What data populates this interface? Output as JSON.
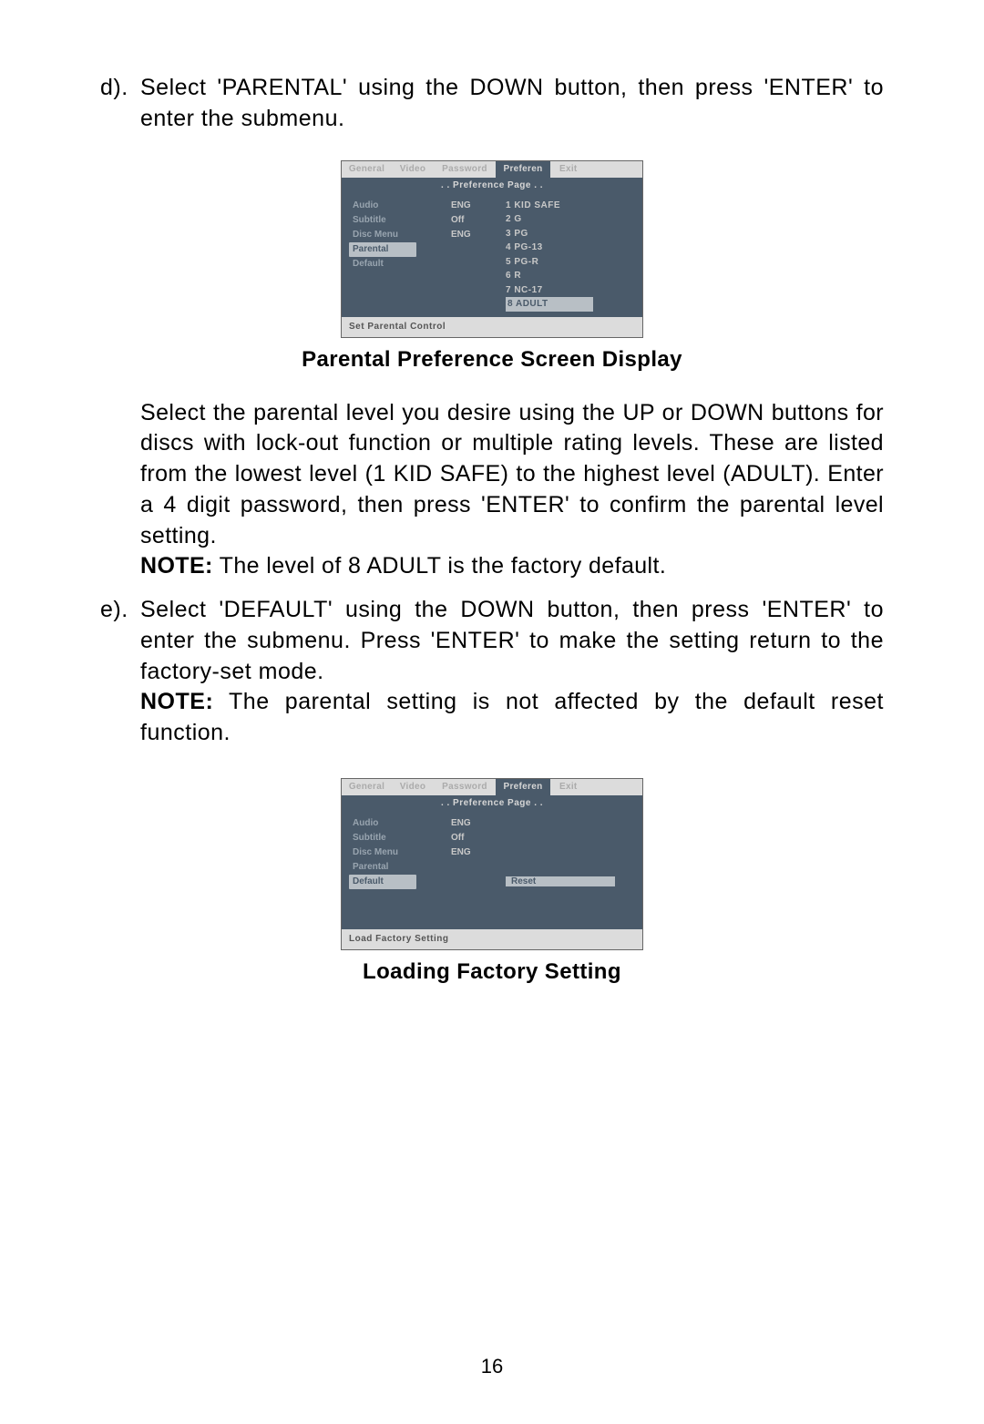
{
  "step_d": {
    "marker": "d).",
    "text": "Select 'PARENTAL' using the DOWN button, then press 'ENTER' to enter the submenu."
  },
  "figure1": {
    "tabs": {
      "general": "General",
      "video": "Video",
      "password": "Password",
      "preferen": "Preferen",
      "exit": "Exit"
    },
    "title": ". . Preference Page . .",
    "menu_items": [
      "Audio",
      "Subtitle",
      "Disc Menu",
      "Parental",
      "Default"
    ],
    "menu_selected_index": 3,
    "mid_values": [
      "ENG",
      "Off",
      "ENG"
    ],
    "right_items": [
      "1 KID SAFE",
      "2 G",
      "3 PG",
      "4 PG-13",
      "5 PG-R",
      "6 R",
      "7 NC-17",
      "8 ADULT"
    ],
    "right_selected_index": 7,
    "footer": "Set Parental Control"
  },
  "caption1": "Parental Preference Screen Display",
  "body1": {
    "text": "Select the parental level you desire using the UP or DOWN buttons for discs with lock-out function or multiple rating levels. These are listed from the lowest level (1 KID SAFE) to the highest level (ADULT). Enter a 4 digit password, then press 'ENTER' to confirm the parental level setting.",
    "note_lead": "NOTE:",
    "note_text": " The level of 8 ADULT is the factory default."
  },
  "step_e": {
    "marker": "e).",
    "text": "Select 'DEFAULT' using the DOWN button, then press 'ENTER' to enter the submenu. Press 'ENTER' to make the setting return to the factory-set mode.",
    "note_lead": "NOTE:",
    "note_text": " The parental setting is not affected by the default reset function."
  },
  "figure2": {
    "tabs": {
      "general": "General",
      "video": "Video",
      "password": "Password",
      "preferen": "Preferen",
      "exit": "Exit"
    },
    "title": ". . Preference Page . .",
    "menu_items": [
      "Audio",
      "Subtitle",
      "Disc Menu",
      "Parental",
      "Default"
    ],
    "menu_selected_index": 4,
    "mid_values": [
      "ENG",
      "Off",
      "ENG"
    ],
    "right_reset": "Reset",
    "footer": "Load Factory Setting"
  },
  "caption2": "Loading Factory Setting",
  "page_number": "16"
}
